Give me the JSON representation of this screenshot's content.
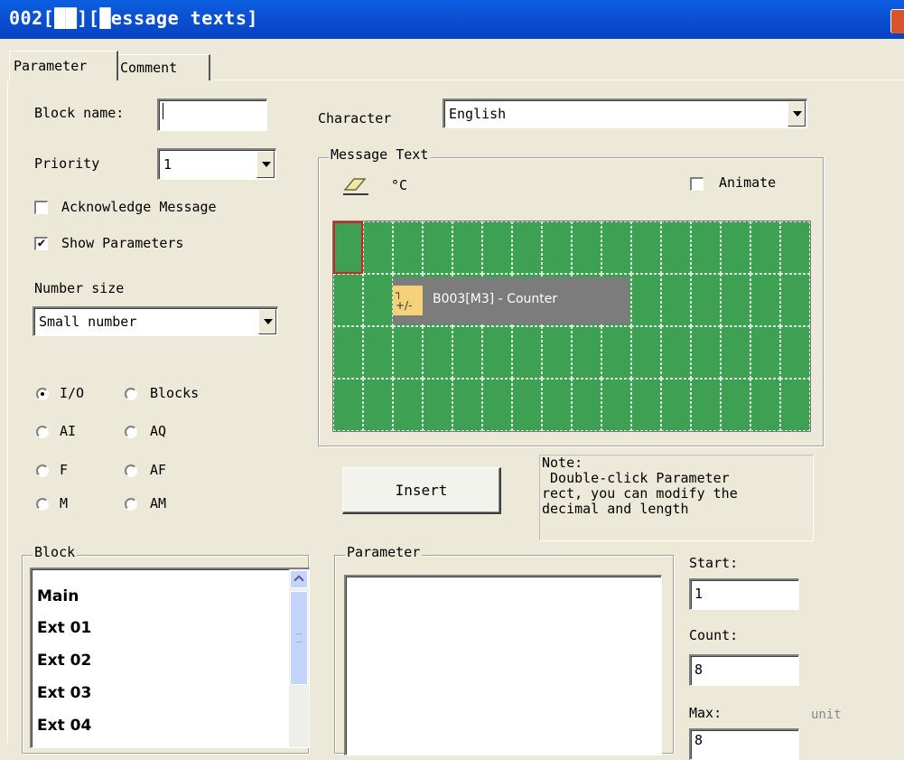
{
  "window": {
    "title": "002[██][█essage texts]"
  },
  "tabs": [
    {
      "label": "Parameter"
    },
    {
      "label": "Comment"
    }
  ],
  "form": {
    "block_name_label": "Block name:",
    "block_name_value": "",
    "priority_label": "Priority",
    "priority_value": "1",
    "acknowledge_label": "Acknowledge Message",
    "acknowledge_checked": false,
    "show_params_label": "Show Parameters",
    "show_params_checked": true,
    "check_mark": "✔",
    "number_size_label": "Number size",
    "number_size_value": "Small number"
  },
  "radios": [
    {
      "label": "I/O",
      "selected": true
    },
    {
      "label": "Blocks",
      "selected": false
    },
    {
      "label": "AI",
      "selected": false
    },
    {
      "label": "AQ",
      "selected": false
    },
    {
      "label": "F",
      "selected": false
    },
    {
      "label": "AF",
      "selected": false
    },
    {
      "label": "M",
      "selected": false
    },
    {
      "label": "AM",
      "selected": false
    }
  ],
  "character": {
    "label": "Character",
    "value": "English"
  },
  "message_text": {
    "group_label": "Message Text",
    "degree_label": "°C",
    "animate_label": "Animate",
    "animate_checked": false,
    "grid": {
      "rows": 4,
      "cols": 16
    },
    "parameter_chip": {
      "label": "B003[M3] - Counter",
      "icon_text": "+/-"
    }
  },
  "insert_button": "Insert",
  "note": {
    "line1": "Note:",
    "line2": " Double-click Parameter",
    "line3": "rect, you can modify the",
    "line4": "decimal and length"
  },
  "block_group": {
    "label": "Block",
    "items": [
      "Main",
      "Ext 01",
      "Ext 02",
      "Ext 03",
      "Ext 04"
    ]
  },
  "parameter_group": {
    "label": "Parameter"
  },
  "start": {
    "label": "Start:",
    "value": "1"
  },
  "count": {
    "label": "Count:",
    "value": "8"
  },
  "max": {
    "label": "Max:",
    "value": "8",
    "unit_label": "unit"
  },
  "colors": {
    "lcd_green": "#3ea052",
    "title_blue": "#0a5fe0",
    "selection_red": "#d62020"
  }
}
